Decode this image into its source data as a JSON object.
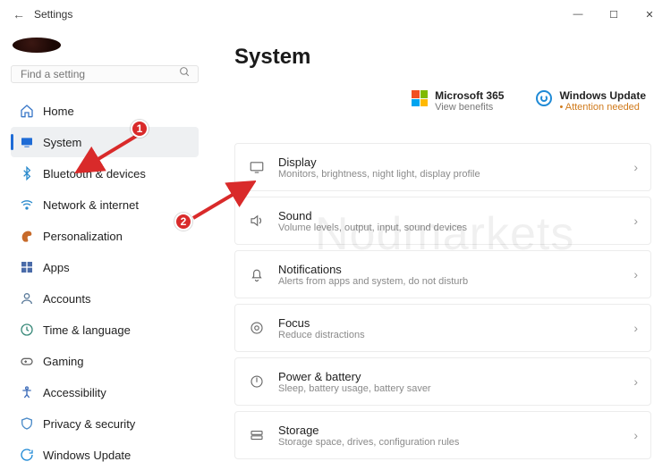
{
  "titlebar": {
    "title": "Settings"
  },
  "search": {
    "placeholder": "Find a setting"
  },
  "nav": {
    "items": [
      {
        "label": "Home"
      },
      {
        "label": "System"
      },
      {
        "label": "Bluetooth & devices"
      },
      {
        "label": "Network & internet"
      },
      {
        "label": "Personalization"
      },
      {
        "label": "Apps"
      },
      {
        "label": "Accounts"
      },
      {
        "label": "Time & language"
      },
      {
        "label": "Gaming"
      },
      {
        "label": "Accessibility"
      },
      {
        "label": "Privacy & security"
      },
      {
        "label": "Windows Update"
      }
    ],
    "active_index": 1
  },
  "page": {
    "title": "System"
  },
  "top": {
    "ms365": {
      "title": "Microsoft 365",
      "sub": "View benefits"
    },
    "wu": {
      "title": "Windows Update",
      "sub": "• Attention needed"
    }
  },
  "cards": [
    {
      "title": "Display",
      "sub": "Monitors, brightness, night light, display profile"
    },
    {
      "title": "Sound",
      "sub": "Volume levels, output, input, sound devices"
    },
    {
      "title": "Notifications",
      "sub": "Alerts from apps and system, do not disturb"
    },
    {
      "title": "Focus",
      "sub": "Reduce distractions"
    },
    {
      "title": "Power & battery",
      "sub": "Sleep, battery usage, battery saver"
    },
    {
      "title": "Storage",
      "sub": "Storage space, drives, configuration rules"
    }
  ],
  "callouts": {
    "one": "1",
    "two": "2"
  },
  "watermark": "Nodmarkets"
}
